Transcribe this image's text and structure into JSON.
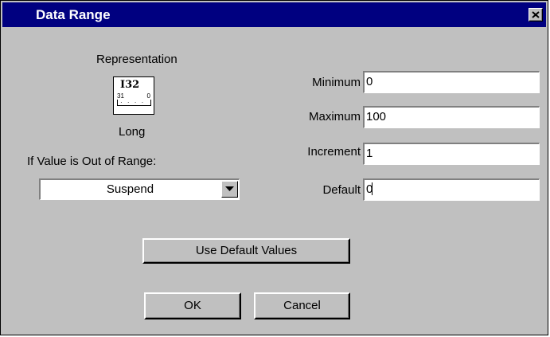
{
  "dialog": {
    "title": "Data Range"
  },
  "representation": {
    "heading": "Representation",
    "icon_text": "I32",
    "icon_bit_high": "31",
    "icon_bit_low": "0",
    "type_label": "Long"
  },
  "out_of_range": {
    "label": "If Value is Out of Range:",
    "selected": "Suspend"
  },
  "fields": {
    "minimum": {
      "label": "Minimum",
      "value": "0"
    },
    "maximum": {
      "label": "Maximum",
      "value": "100"
    },
    "increment": {
      "label": "Increment",
      "value": "1"
    },
    "default": {
      "label": "Default",
      "value": "0"
    }
  },
  "buttons": {
    "use_defaults": "Use Default Values",
    "ok": "OK",
    "cancel": "Cancel"
  },
  "icons": {
    "close": "close-icon",
    "dropdown": "chevron-down-icon",
    "representation": "i32-representation-icon"
  },
  "colors": {
    "titlebar": "#000080",
    "face": "#c0c0c0"
  }
}
